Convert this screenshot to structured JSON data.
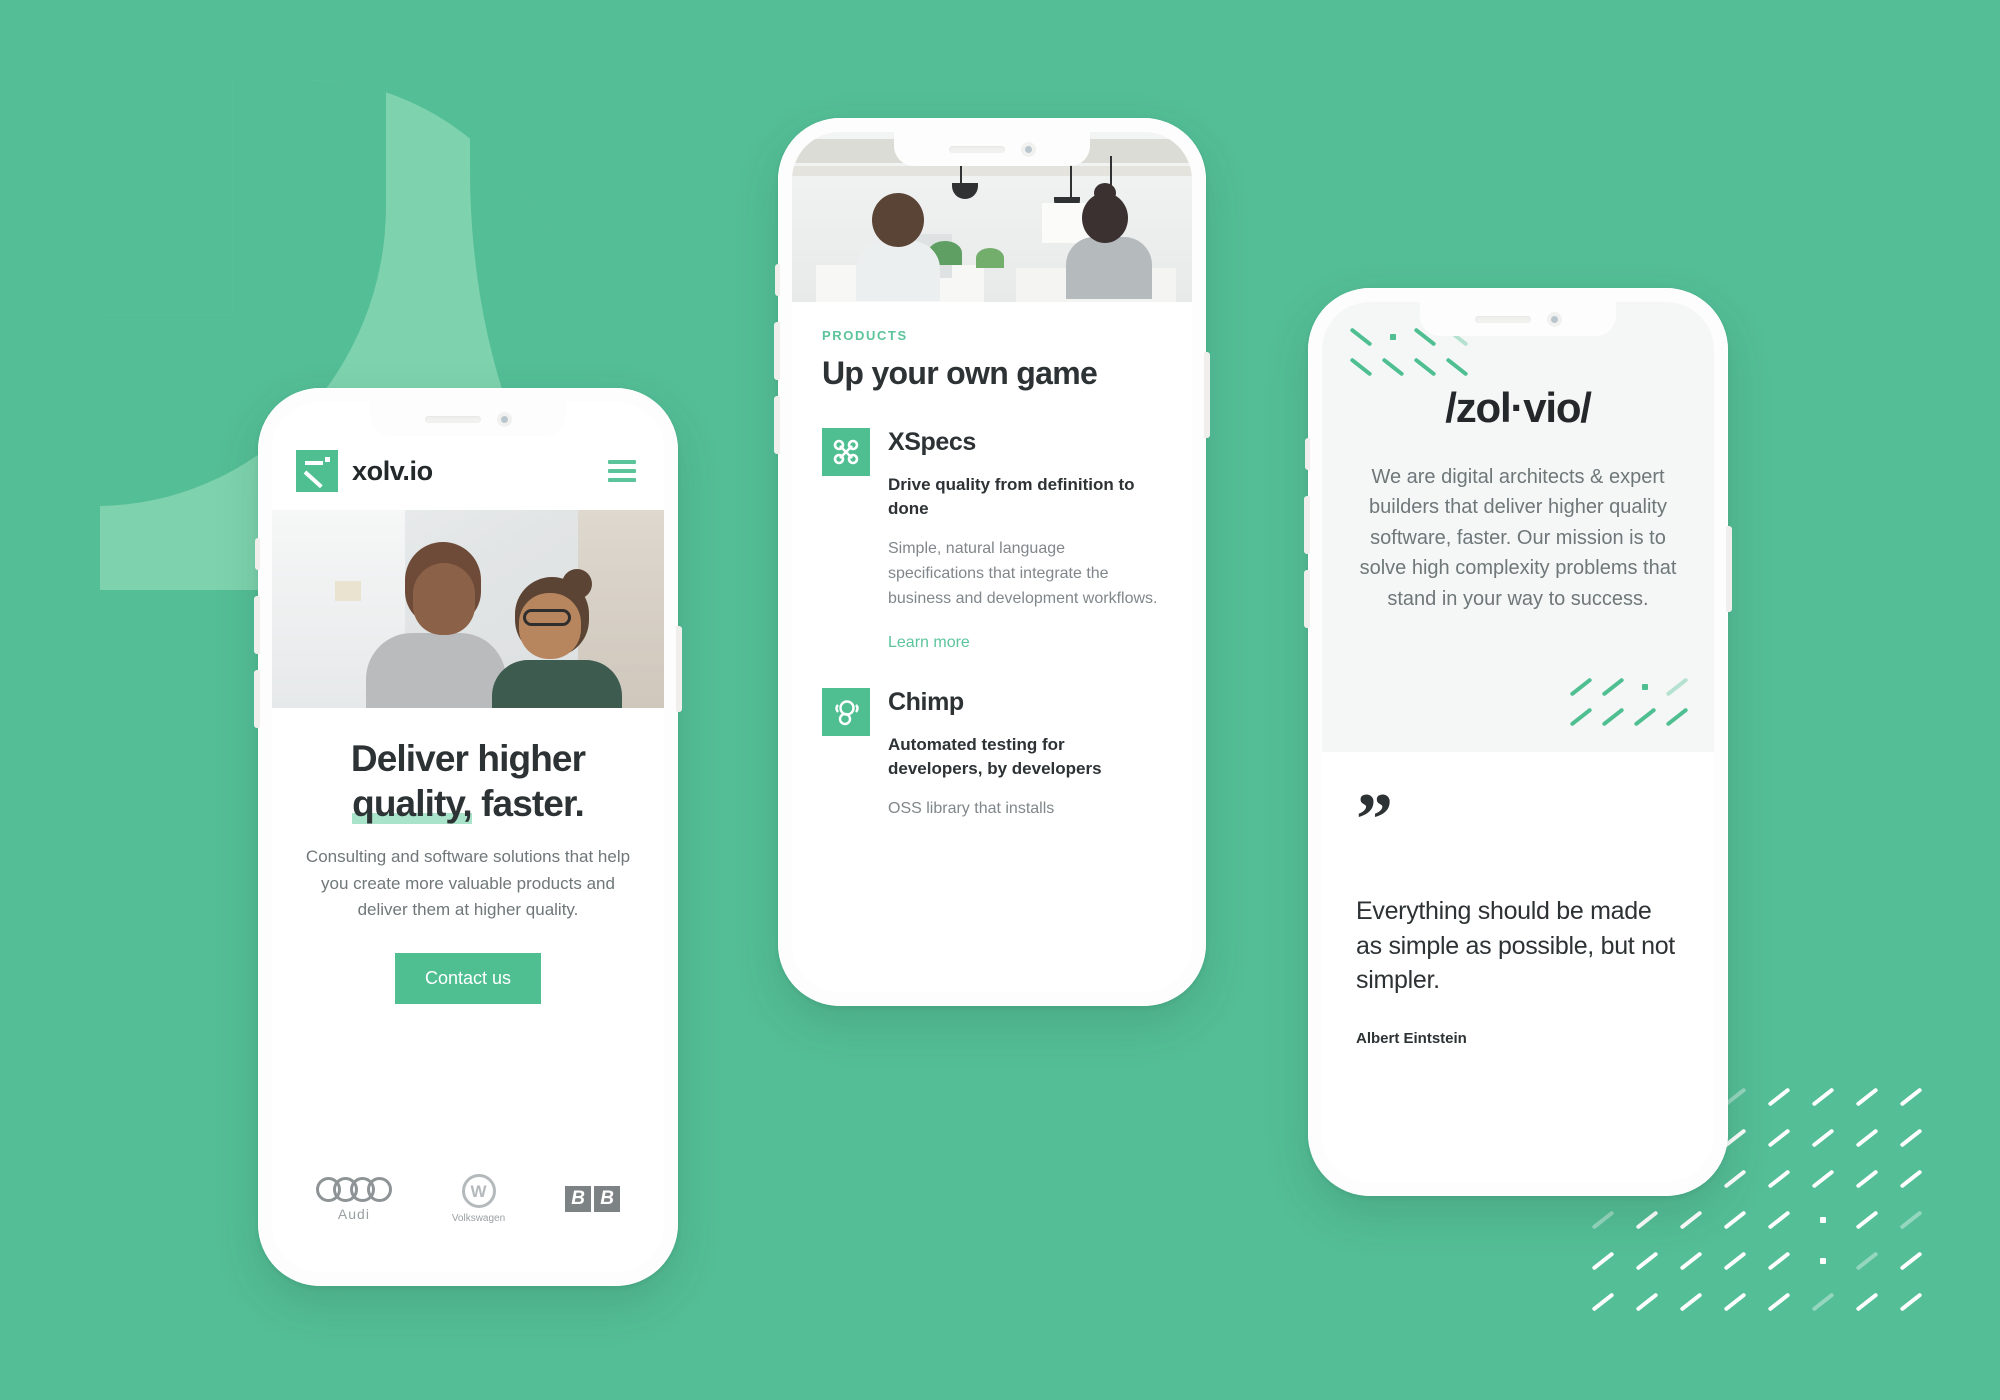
{
  "colors": {
    "background_green": "#54be96",
    "accent_green": "#4fbf92",
    "light_green_shape": "#7ed3ae",
    "highlight_green": "#a9e3c9",
    "panel_grey": "#f4f7f6",
    "text_dark": "#2d3234",
    "text_muted": "#6f7779"
  },
  "phone_one": {
    "header": {
      "brand_name": "xolv.io",
      "logo_icon": "xolvio-mark-icon",
      "menu_icon": "hamburger-menu-icon"
    },
    "hero": {
      "photo_alt": "two-colleagues-smiling-at-laptop",
      "title_line_one": "Deliver higher",
      "title_highlight": "quality,",
      "title_rest": " faster.",
      "subtitle": "Consulting and software solutions that help you create more valuable products and deliver them at higher quality.",
      "cta_label": "Contact us"
    },
    "client_logos": [
      {
        "name": "Audi",
        "label": "Audi",
        "icon": "audi-rings-icon"
      },
      {
        "name": "Volkswagen",
        "label": "Volkswagen",
        "icon": "vw-roundel-icon"
      },
      {
        "name": "BBC",
        "label": "BBC",
        "icon": "bbc-blocks-icon"
      }
    ]
  },
  "phone_two": {
    "photo_alt": "open-plan-office-two-women-working",
    "eyebrow": "PRODUCTS",
    "section_title": "Up your own game",
    "products": [
      {
        "name": "XSpecs",
        "icon": "xspecs-knot-icon",
        "tagline": "Drive quality from definition to done",
        "description": "Simple, natural language specifications that integrate the business and development workflows.",
        "link_label": "Learn more"
      },
      {
        "name": "Chimp",
        "icon": "chimp-head-icon",
        "tagline": "Automated testing for developers, by developers",
        "description": "OSS library that installs"
      }
    ]
  },
  "phone_three": {
    "about": {
      "logo": "/zol·vio/",
      "text": "We are digital architects & expert builders that deliver higher quality software, faster. Our mission is to solve high complexity problems that stand in your way to success."
    },
    "quote": {
      "mark": "”",
      "text": "Everything should be made as simple as possible, but not simpler.",
      "author": "Albert Eintstein"
    }
  }
}
